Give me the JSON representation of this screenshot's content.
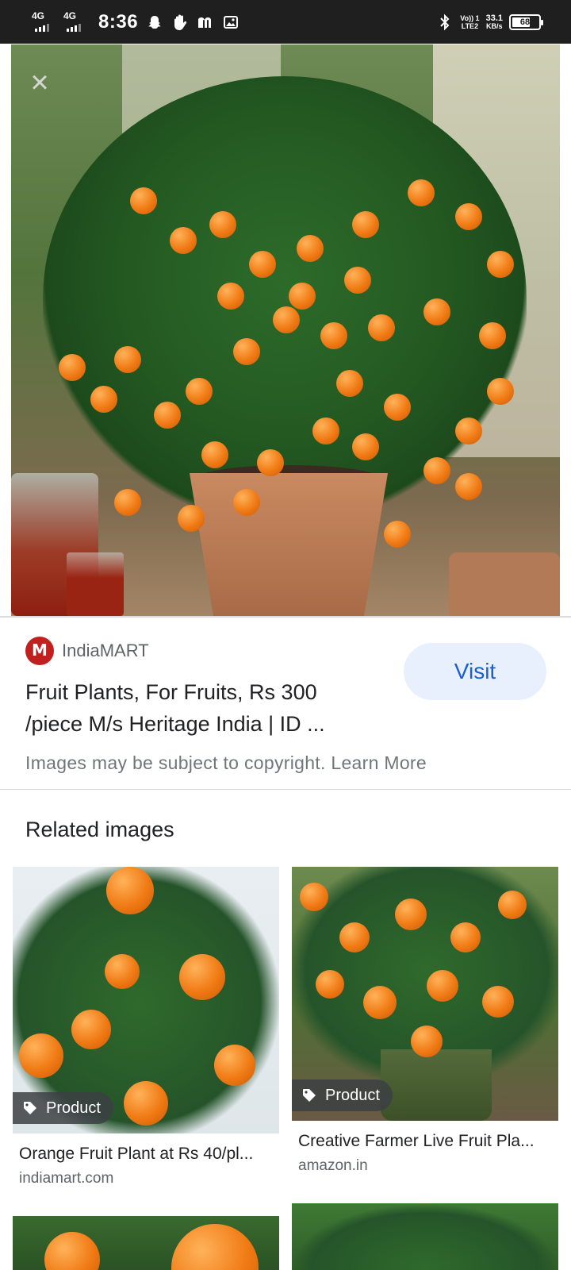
{
  "status_bar": {
    "net1": "4G",
    "net2": "4G",
    "time": "8:36",
    "net_right_top": "Vo)) 1",
    "net_right_bottom": "LTE2",
    "speed_value": "33.1",
    "speed_unit": "KB/s",
    "battery": "68",
    "icons": [
      "snapchat-icon",
      "hand-icon",
      "m-app-icon",
      "gallery-icon",
      "bluetooth-icon"
    ]
  },
  "viewer": {
    "close_icon": "close-icon",
    "image_desc_icon": "orange-tree-image"
  },
  "source": {
    "name": "IndiaMART",
    "title": "Fruit Plants, For Fruits, Rs 300 /piece M/s Heritage India | ID ...",
    "visit_label": "Visit",
    "copyright": "Images may be subject to copyright. Learn More"
  },
  "related": {
    "heading": "Related images",
    "items": [
      {
        "badge": "Product",
        "title": "Orange Fruit Plant at Rs 40/pl...",
        "source": "indiamart.com"
      },
      {
        "badge": "Product",
        "title": "Creative Farmer Live Fruit Pla...",
        "source": "amazon.in"
      }
    ]
  },
  "colors": {
    "accent": "#1a5fd0",
    "visit_bg": "#e8f0fe",
    "statusbar": "#1f1f1f"
  }
}
